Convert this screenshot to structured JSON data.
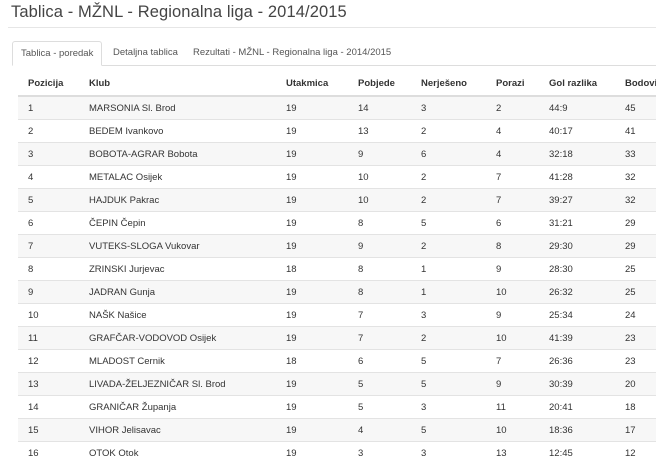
{
  "page": {
    "title": "Tablica - MŽNL - Regionalna liga - 2014/2015"
  },
  "tabs": [
    {
      "label": "Tablica - poredak",
      "active": true
    },
    {
      "label": "Detaljna tablica",
      "active": false
    },
    {
      "label": "Rezultati - MŽNL - Regionalna liga - 2014/2015",
      "active": false
    }
  ],
  "table": {
    "headers": {
      "pozicija": "Pozicija",
      "klub": "Klub",
      "utakmica": "Utakmica",
      "pobjede": "Pobjede",
      "nerijeseno": "Nerješeno",
      "porazi": "Porazi",
      "gol_razlika": "Gol razlika",
      "bodovi": "Bodovi"
    },
    "rows": [
      {
        "pozicija": "1",
        "klub": "MARSONIA Sl. Brod",
        "utakmica": "19",
        "pobjede": "14",
        "nerijeseno": "3",
        "porazi": "2",
        "gol_razlika": "44:9",
        "bodovi": "45"
      },
      {
        "pozicija": "2",
        "klub": "BEDEM Ivankovo",
        "utakmica": "19",
        "pobjede": "13",
        "nerijeseno": "2",
        "porazi": "4",
        "gol_razlika": "40:17",
        "bodovi": "41"
      },
      {
        "pozicija": "3",
        "klub": "BOBOTA-AGRAR Bobota",
        "utakmica": "19",
        "pobjede": "9",
        "nerijeseno": "6",
        "porazi": "4",
        "gol_razlika": "32:18",
        "bodovi": "33"
      },
      {
        "pozicija": "4",
        "klub": "METALAC Osijek",
        "utakmica": "19",
        "pobjede": "10",
        "nerijeseno": "2",
        "porazi": "7",
        "gol_razlika": "41:28",
        "bodovi": "32"
      },
      {
        "pozicija": "5",
        "klub": "HAJDUK Pakrac",
        "utakmica": "19",
        "pobjede": "10",
        "nerijeseno": "2",
        "porazi": "7",
        "gol_razlika": "39:27",
        "bodovi": "32"
      },
      {
        "pozicija": "6",
        "klub": "ČEPIN Čepin",
        "utakmica": "19",
        "pobjede": "8",
        "nerijeseno": "5",
        "porazi": "6",
        "gol_razlika": "31:21",
        "bodovi": "29"
      },
      {
        "pozicija": "7",
        "klub": "VUTEKS-SLOGA Vukovar",
        "utakmica": "19",
        "pobjede": "9",
        "nerijeseno": "2",
        "porazi": "8",
        "gol_razlika": "29:30",
        "bodovi": "29"
      },
      {
        "pozicija": "8",
        "klub": "ZRINSKI Jurjevac",
        "utakmica": "18",
        "pobjede": "8",
        "nerijeseno": "1",
        "porazi": "9",
        "gol_razlika": "28:30",
        "bodovi": "25"
      },
      {
        "pozicija": "9",
        "klub": "JADRAN Gunja",
        "utakmica": "19",
        "pobjede": "8",
        "nerijeseno": "1",
        "porazi": "10",
        "gol_razlika": "26:32",
        "bodovi": "25"
      },
      {
        "pozicija": "10",
        "klub": "NAŠK Našice",
        "utakmica": "19",
        "pobjede": "7",
        "nerijeseno": "3",
        "porazi": "9",
        "gol_razlika": "25:34",
        "bodovi": "24"
      },
      {
        "pozicija": "11",
        "klub": "GRAFČAR-VODOVOD Osijek",
        "utakmica": "19",
        "pobjede": "7",
        "nerijeseno": "2",
        "porazi": "10",
        "gol_razlika": "41:39",
        "bodovi": "23"
      },
      {
        "pozicija": "12",
        "klub": "MLADOST Cernik",
        "utakmica": "18",
        "pobjede": "6",
        "nerijeseno": "5",
        "porazi": "7",
        "gol_razlika": "26:36",
        "bodovi": "23"
      },
      {
        "pozicija": "13",
        "klub": "LIVADA-ŽELJEZNIČAR Sl. Brod",
        "utakmica": "19",
        "pobjede": "5",
        "nerijeseno": "5",
        "porazi": "9",
        "gol_razlika": "30:39",
        "bodovi": "20"
      },
      {
        "pozicija": "14",
        "klub": "GRANIČAR Županja",
        "utakmica": "19",
        "pobjede": "5",
        "nerijeseno": "3",
        "porazi": "11",
        "gol_razlika": "20:41",
        "bodovi": "18"
      },
      {
        "pozicija": "15",
        "klub": "VIHOR Jelisavac",
        "utakmica": "19",
        "pobjede": "4",
        "nerijeseno": "5",
        "porazi": "10",
        "gol_razlika": "18:36",
        "bodovi": "17"
      },
      {
        "pozicija": "16",
        "klub": "OTOK Otok",
        "utakmica": "19",
        "pobjede": "3",
        "nerijeseno": "3",
        "porazi": "13",
        "gol_razlika": "12:45",
        "bodovi": "12"
      }
    ]
  }
}
